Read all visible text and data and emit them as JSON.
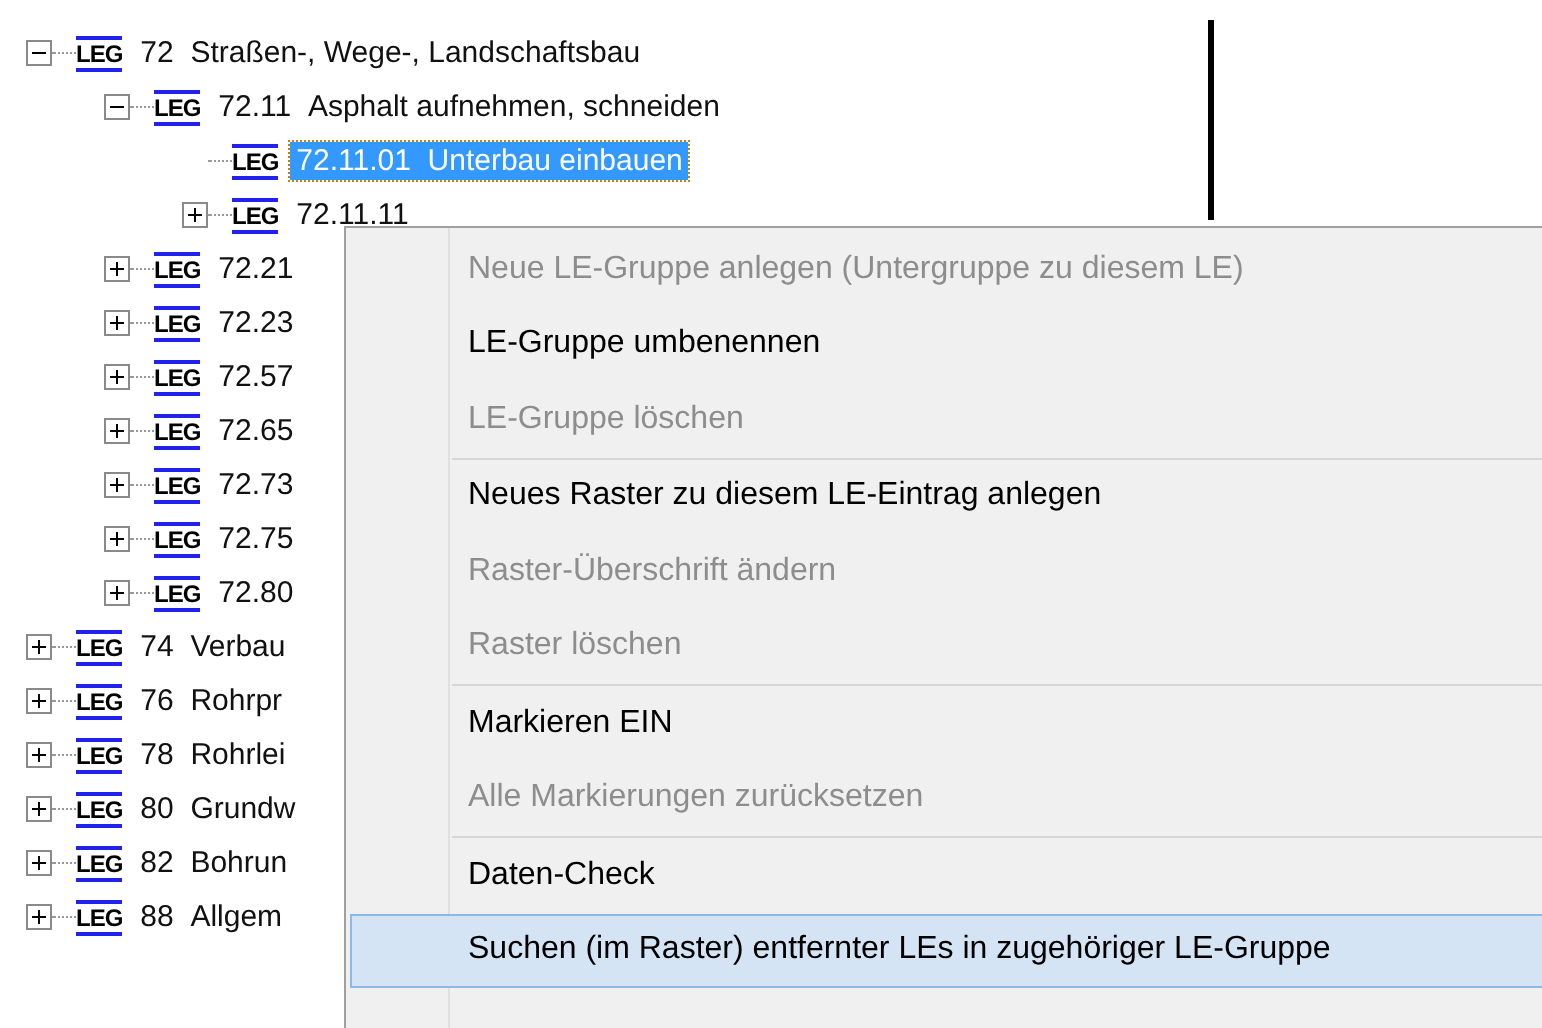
{
  "tree": [
    {
      "badge": "LEG",
      "number": "72",
      "name": "Straßen-, Wege-, Landschaftsbau",
      "expanded": true,
      "selected": false,
      "children": [
        {
          "badge": "LEG",
          "number": "72.11",
          "name": "Asphalt aufnehmen, schneiden",
          "expanded": true,
          "selected": false,
          "children": [
            {
              "badge": "LEG",
              "number": "72.11.01",
              "name": "Unterbau einbauen",
              "selected": true
            },
            {
              "badge": "LEG",
              "number": "72.11.11",
              "expanded": false,
              "selected": false
            }
          ]
        },
        {
          "badge": "LEG",
          "number": "72.21",
          "expanded": false,
          "selected": false
        },
        {
          "badge": "LEG",
          "number": "72.23",
          "expanded": false,
          "selected": false
        },
        {
          "badge": "LEG",
          "number": "72.57",
          "expanded": false,
          "selected": false
        },
        {
          "badge": "LEG",
          "number": "72.65",
          "expanded": false,
          "selected": false
        },
        {
          "badge": "LEG",
          "number": "72.73",
          "expanded": false,
          "selected": false
        },
        {
          "badge": "LEG",
          "number": "72.75",
          "expanded": false,
          "selected": false
        },
        {
          "badge": "LEG",
          "number": "72.80",
          "expanded": false,
          "selected": false
        }
      ]
    },
    {
      "badge": "LEG",
      "number": "74",
      "name": "Verbau",
      "expanded": false,
      "selected": false
    },
    {
      "badge": "LEG",
      "number": "76",
      "name": "Rohrpr",
      "expanded": false,
      "selected": false
    },
    {
      "badge": "LEG",
      "number": "78",
      "name": "Rohrlei",
      "expanded": false,
      "selected": false
    },
    {
      "badge": "LEG",
      "number": "80",
      "name": "Grundw",
      "expanded": false,
      "selected": false
    },
    {
      "badge": "LEG",
      "number": "82",
      "name": "Bohrun",
      "expanded": false,
      "selected": false
    },
    {
      "badge": "LEG",
      "number": "88",
      "name": "Allgem",
      "expanded": false,
      "selected": false
    }
  ],
  "context_menu": [
    {
      "kind": "item",
      "label": "Neue LE-Gruppe anlegen (Untergruppe zu diesem LE)",
      "disabled": true,
      "selected": false
    },
    {
      "kind": "item",
      "label": "LE-Gruppe umbenennen",
      "disabled": false,
      "selected": false
    },
    {
      "kind": "item",
      "label": "LE-Gruppe löschen",
      "disabled": true,
      "selected": false
    },
    {
      "kind": "separator"
    },
    {
      "kind": "item",
      "label": "Neues Raster zu diesem LE-Eintrag anlegen",
      "disabled": false,
      "selected": false
    },
    {
      "kind": "item",
      "label": "Raster-Überschrift ändern",
      "disabled": true,
      "selected": false
    },
    {
      "kind": "item",
      "label": "Raster löschen",
      "disabled": true,
      "selected": false
    },
    {
      "kind": "separator"
    },
    {
      "kind": "item",
      "label": "Markieren EIN",
      "disabled": false,
      "selected": false
    },
    {
      "kind": "item",
      "label": "Alle Markierungen zurücksetzen",
      "disabled": true,
      "selected": false
    },
    {
      "kind": "separator"
    },
    {
      "kind": "item",
      "label": "Daten-Check",
      "disabled": false,
      "selected": false
    },
    {
      "kind": "item",
      "label": "Suchen (im Raster) entfernter LEs in zugehöriger LE-Gruppe",
      "disabled": false,
      "selected": true
    }
  ]
}
